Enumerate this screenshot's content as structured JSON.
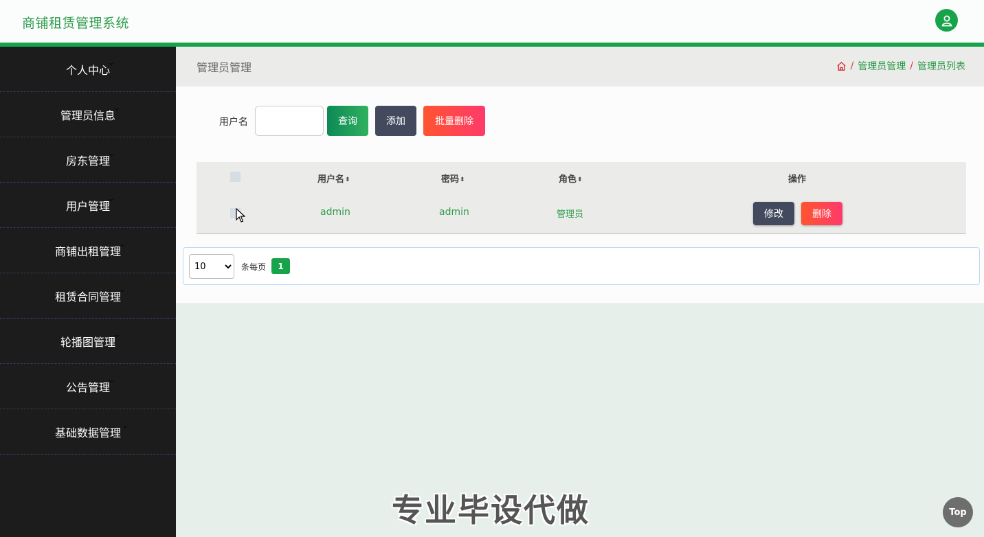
{
  "app": {
    "title": "商铺租赁管理系统"
  },
  "sidebar": {
    "items": [
      {
        "label": "个人中心"
      },
      {
        "label": "管理员信息"
      },
      {
        "label": "房东管理"
      },
      {
        "label": "用户管理"
      },
      {
        "label": "商铺出租管理"
      },
      {
        "label": "租赁合同管理"
      },
      {
        "label": "轮播图管理"
      },
      {
        "label": "公告管理"
      },
      {
        "label": "基础数据管理"
      }
    ]
  },
  "breadcrumb": {
    "page_title": "管理员管理",
    "path": [
      "管理员管理",
      "管理员列表"
    ]
  },
  "search": {
    "label": "用户名",
    "value": "",
    "query_label": "查询",
    "add_label": "添加",
    "batch_delete_label": "批量删除"
  },
  "table": {
    "headers": [
      "用户名",
      "密码",
      "角色",
      "操作"
    ],
    "rows": [
      {
        "username": "admin",
        "password": "admin",
        "role": "管理员",
        "edit": "修改",
        "delete": "删除"
      }
    ]
  },
  "pagination": {
    "page_size": "10",
    "page_size_options": [
      "10"
    ],
    "per_page_label": "条每页",
    "current_page": "1"
  },
  "watermark": "专业毕设代做",
  "top_button": "Top",
  "colors": {
    "accent": "#16a34a",
    "sidebar_bg": "#1b1c1b",
    "danger": "#ff3a6b",
    "dark_button": "#434a5e"
  }
}
